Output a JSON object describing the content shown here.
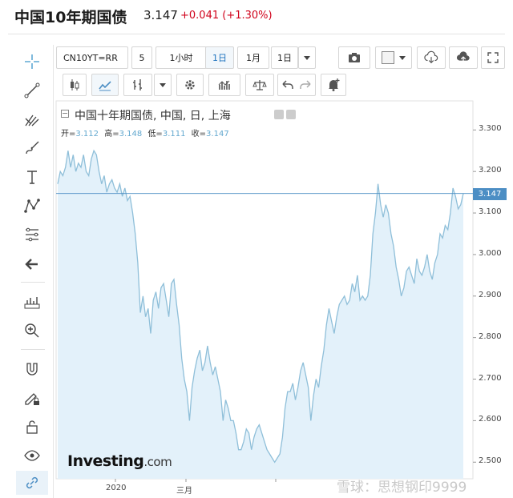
{
  "header": {
    "title": "中国10年期国债",
    "price": "3.147",
    "change": "+0.041 (+1.30%)"
  },
  "toolbar": {
    "symbol": "CN10YT=RR",
    "b_5": "5",
    "b_1h": "1小时",
    "b_1d": "1日",
    "b_1m": "1月",
    "b_1d2": "1日"
  },
  "legend": {
    "title": "中国十年期国债, 中国, 日, 上海",
    "open_label": "开=",
    "open": "3.112",
    "high_label": "高=",
    "high": "3.148",
    "low_label": "低=",
    "low": "3.111",
    "close_label": "收=",
    "close": "3.147"
  },
  "brand": {
    "name": "Investing",
    "suffix": ".com"
  },
  "watermark": "雪球：思想钢印9999",
  "colors": {
    "line": "#8fbfd9",
    "fill": "#e3f1fa",
    "accent": "#4c8ec4",
    "down": "#d0021b"
  },
  "chart_data": {
    "type": "area",
    "ylim": [
      2.46,
      3.37
    ],
    "yticks": [
      "3.300",
      "3.200",
      "3.100",
      "3.000",
      "2.900",
      "2.800",
      "2.700",
      "2.600",
      "2.500"
    ],
    "xticks": [
      "2020",
      "三月"
    ],
    "last_value": "3.147",
    "last": 3.147,
    "values": [
      3.17,
      3.2,
      3.19,
      3.21,
      3.25,
      3.21,
      3.24,
      3.2,
      3.22,
      3.21,
      3.24,
      3.2,
      3.19,
      3.23,
      3.25,
      3.24,
      3.2,
      3.17,
      3.19,
      3.15,
      3.17,
      3.18,
      3.16,
      3.15,
      3.17,
      3.14,
      3.16,
      3.13,
      3.14,
      3.1,
      3.05,
      2.98,
      2.86,
      2.9,
      2.85,
      2.87,
      2.81,
      2.89,
      2.91,
      2.87,
      2.92,
      2.93,
      2.89,
      2.85,
      2.93,
      2.94,
      2.88,
      2.83,
      2.75,
      2.7,
      2.67,
      2.6,
      2.68,
      2.72,
      2.75,
      2.77,
      2.72,
      2.74,
      2.78,
      2.74,
      2.71,
      2.73,
      2.7,
      2.67,
      2.6,
      2.65,
      2.63,
      2.6,
      2.6,
      2.57,
      2.53,
      2.53,
      2.55,
      2.58,
      2.57,
      2.53,
      2.56,
      2.58,
      2.59,
      2.57,
      2.55,
      2.53,
      2.52,
      2.51,
      2.5,
      2.51,
      2.52,
      2.56,
      2.63,
      2.67,
      2.67,
      2.69,
      2.65,
      2.68,
      2.72,
      2.74,
      2.71,
      2.68,
      2.6,
      2.66,
      2.7,
      2.68,
      2.73,
      2.77,
      2.83,
      2.87,
      2.84,
      2.81,
      2.85,
      2.88,
      2.89,
      2.9,
      2.88,
      2.89,
      2.93,
      2.91,
      2.95,
      2.89,
      2.9,
      2.89,
      2.9,
      2.95,
      3.05,
      3.1,
      3.17,
      3.12,
      3.09,
      3.12,
      3.1,
      3.05,
      3.02,
      2.97,
      2.94,
      2.9,
      2.92,
      2.96,
      2.97,
      2.95,
      2.93,
      2.99,
      2.96,
      2.95,
      2.97,
      3.0,
      2.96,
      2.94,
      2.98,
      3.0,
      3.05,
      3.04,
      3.07,
      3.06,
      3.1,
      3.16,
      3.14,
      3.11,
      3.12,
      3.147
    ],
    "x_title": "",
    "y_title": ""
  }
}
